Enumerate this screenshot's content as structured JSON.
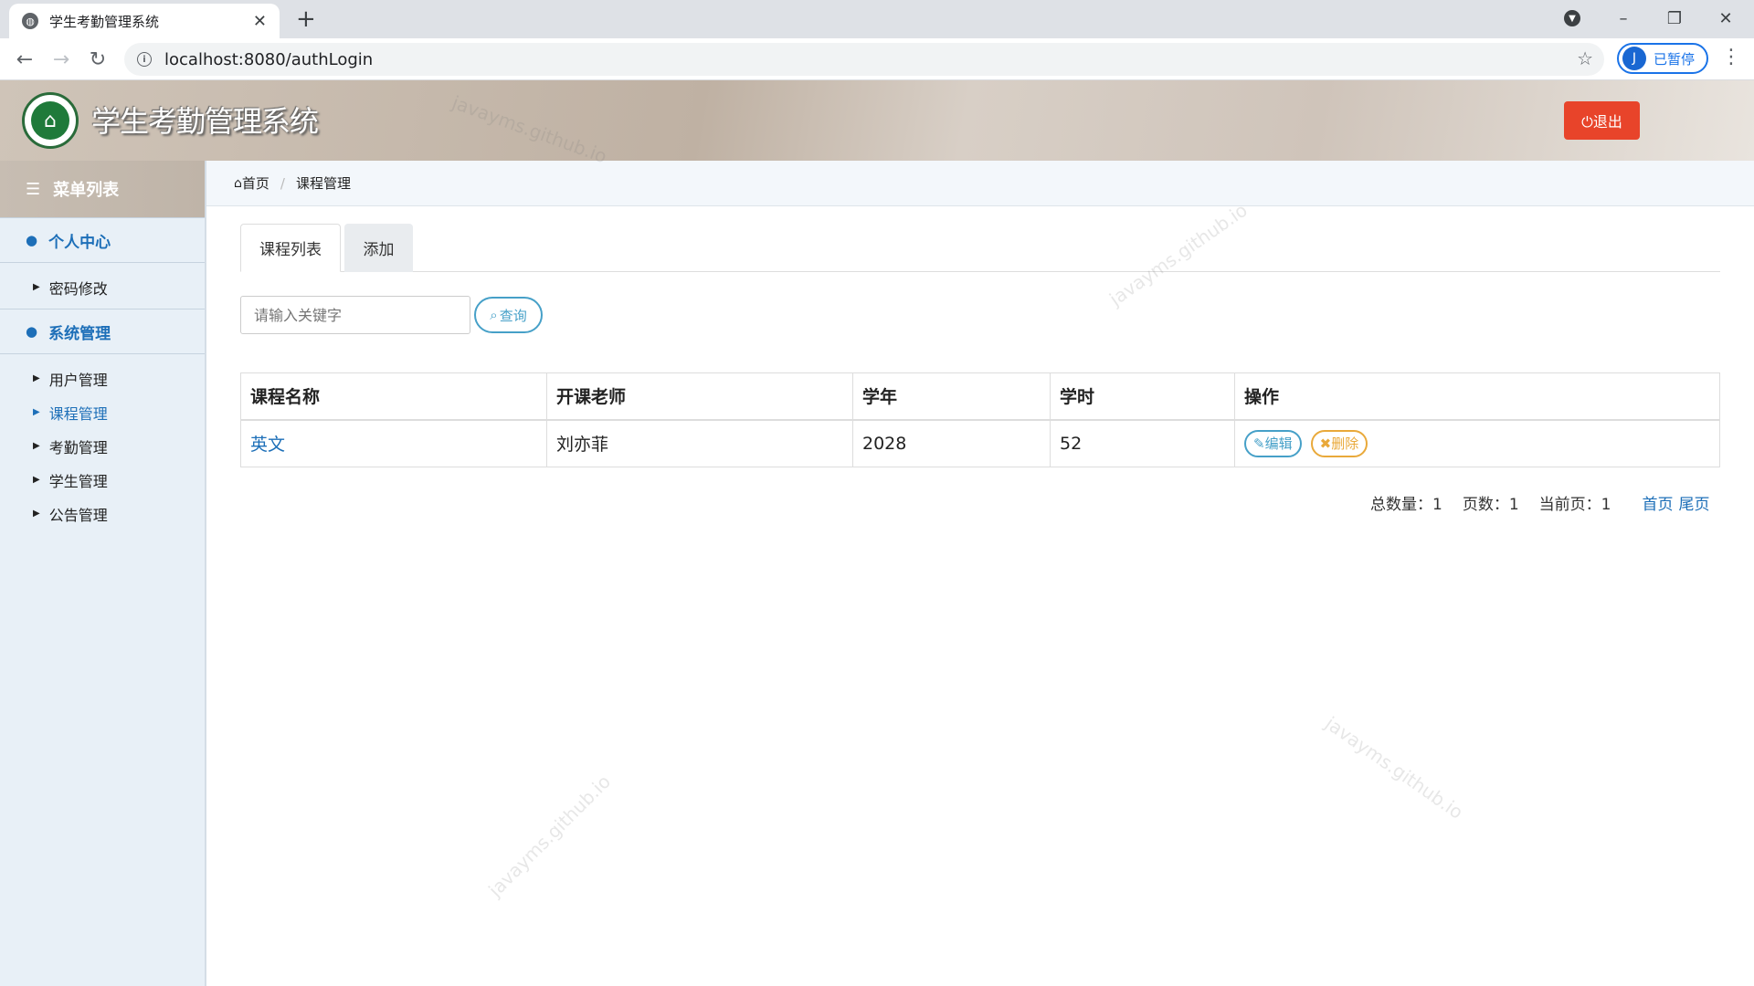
{
  "browser": {
    "tab_title": "学生考勤管理系统",
    "tab_close": "✕",
    "new_tab": "+",
    "url": "localhost:8080/authLogin",
    "profile_initial": "J",
    "profile_label": "已暂停"
  },
  "header": {
    "title": "学生考勤管理系统",
    "logout_label": "⏻退出"
  },
  "sidebar": {
    "menu_title": "菜单列表",
    "groups": [
      {
        "label": "个人中心",
        "items": [
          {
            "label": "密码修改"
          }
        ]
      },
      {
        "label": "系统管理",
        "items": [
          {
            "label": "用户管理"
          },
          {
            "label": "课程管理",
            "active": true
          },
          {
            "label": "考勤管理"
          },
          {
            "label": "学生管理"
          },
          {
            "label": "公告管理"
          }
        ]
      }
    ]
  },
  "breadcrumb": {
    "home": "首页",
    "current": "课程管理"
  },
  "tabs": [
    {
      "label": "课程列表"
    },
    {
      "label": "添加"
    }
  ],
  "search": {
    "placeholder": "请输入关键字",
    "button_label": "查询"
  },
  "table": {
    "headers": [
      "课程名称",
      "开课老师",
      "学年",
      "学时",
      "操作"
    ],
    "rows": [
      {
        "name": "英文",
        "teacher": "刘亦菲",
        "year": "2028",
        "hours": "52",
        "edit": "编辑",
        "delete": "删除"
      }
    ]
  },
  "pager": {
    "total": "总数量：1",
    "pages": "页数：1",
    "current": "当前页：1",
    "first": "首页",
    "last": "尾页"
  },
  "watermark": "javayms.github.io"
}
